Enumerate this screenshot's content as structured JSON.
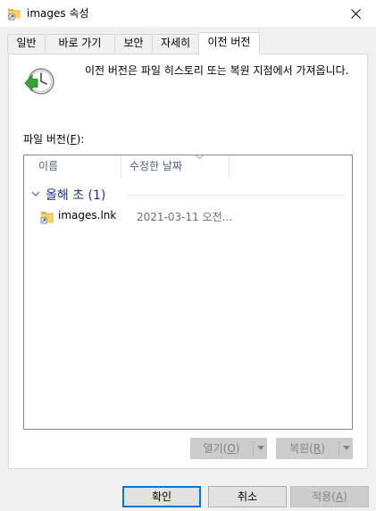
{
  "window": {
    "title": "images 속성",
    "close_icon": "close-icon",
    "folder_icon": "folder-icon"
  },
  "tabs": [
    {
      "label": "일반",
      "active": false
    },
    {
      "label": "바로 가기",
      "active": false
    },
    {
      "label": "보안",
      "active": false
    },
    {
      "label": "자세히",
      "active": false
    },
    {
      "label": "이전 버전",
      "active": true
    }
  ],
  "panel": {
    "description": "이전 버전은 파일 히스토리 또는 복원 지점에서 가져옵니다.",
    "file_versions_label_prefix": "파일 버전(",
    "file_versions_hotkey": "F",
    "file_versions_label_suffix": "):",
    "restore_icon": "file-history-clock-icon"
  },
  "list": {
    "columns": [
      {
        "label": "이름"
      },
      {
        "label": "수정한 날짜",
        "sorted": "descending"
      }
    ],
    "groups": [
      {
        "title": "올해 초 (1)",
        "expanded": true,
        "items": [
          {
            "name": "images.lnk",
            "date": "2021-03-11 오전...",
            "icon": "shortcut-folder-icon"
          }
        ]
      }
    ]
  },
  "actions": {
    "open": {
      "label_prefix": "열기(",
      "hotkey": "O",
      "label_suffix": ")",
      "enabled": false
    },
    "restore": {
      "label_prefix": "복원(",
      "hotkey": "R",
      "label_suffix": ")",
      "enabled": false
    }
  },
  "dialog_buttons": {
    "ok": "확인",
    "cancel": "취소",
    "apply_prefix": "적용(",
    "apply_hotkey": "A",
    "apply_suffix": ")"
  },
  "colors": {
    "accent": "#0078d7",
    "group_title": "#1e3287",
    "column_header": "#4d6082"
  }
}
